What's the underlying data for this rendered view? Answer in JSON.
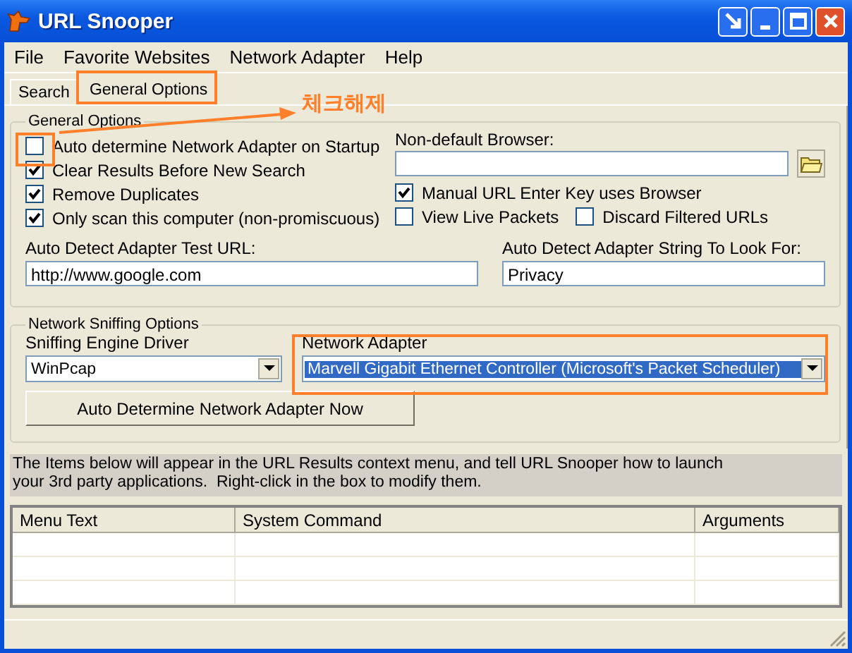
{
  "window": {
    "title": "URL Snooper"
  },
  "menu": [
    {
      "label": "File"
    },
    {
      "label": "Favorite Websites"
    },
    {
      "label": "Network Adapter"
    },
    {
      "label": "Help"
    }
  ],
  "tabs": [
    {
      "label": "Search",
      "selected": false
    },
    {
      "label": "General Options",
      "selected": true
    }
  ],
  "general_options": {
    "title": "General Options",
    "left_checkboxes": [
      {
        "label": "Auto determine Network Adapter on Startup",
        "checked": false
      },
      {
        "label": "Clear Results Before New Search",
        "checked": true
      },
      {
        "label": "Remove Duplicates",
        "checked": true
      },
      {
        "label": "Only scan this computer (non-promiscuous)",
        "checked": true
      }
    ],
    "browser_label": "Non-default Browser:",
    "right_checkboxes": [
      {
        "label": "Manual URL Enter Key uses Browser",
        "checked": true
      },
      {
        "label": "View Live Packets",
        "checked": false
      },
      {
        "label": "Discard Filtered URLs",
        "checked": false
      }
    ],
    "test_url": {
      "label": "Auto Detect Adapter Test URL:",
      "value": "http://www.google.com"
    },
    "look_for": {
      "label": "Auto Detect Adapter String To Look For:",
      "value": "Privacy"
    }
  },
  "sniffing": {
    "title": "Network Sniffing Options",
    "driver": {
      "label": "Sniffing Engine Driver",
      "value": "WinPcap"
    },
    "adapter": {
      "label": "Network Adapter",
      "value": "Marvell Gigabit Ethernet Controller (Microsoft's Packet Scheduler)"
    },
    "button": "Auto Determine Network Adapter Now"
  },
  "description": "The Items below will appear in the URL Results context menu, and tell URL Snooper how to launch\nyour 3rd party applications.  Right-click in the box to modify them.",
  "table": {
    "columns": [
      "Menu Text",
      "System Command",
      "Arguments"
    ]
  },
  "annotation": {
    "text": "체크해제"
  }
}
